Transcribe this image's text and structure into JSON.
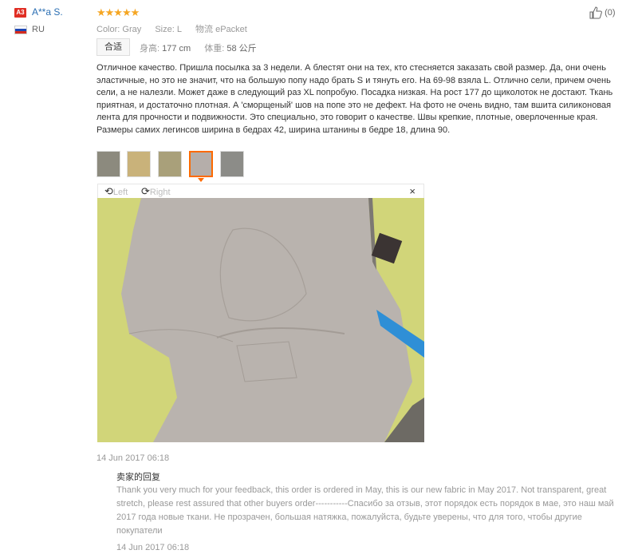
{
  "reviewer": {
    "badge": "A3",
    "name": "A**a S.",
    "country": "RU"
  },
  "rating": {
    "stars": 5,
    "max": 5,
    "glyphs": "★★★★★"
  },
  "attributes": [
    {
      "label": "Color:",
      "value": "Gray"
    },
    {
      "label": "Size:",
      "value": "L"
    },
    {
      "label": "物流",
      "value": "ePacket"
    }
  ],
  "likes": {
    "count": "(0)"
  },
  "fit": {
    "badge": "合适",
    "height_label": "身高:",
    "height_value": "177 cm",
    "weight_label": "体重:",
    "weight_value": "58 公斤"
  },
  "review_text": "Отличное качество. Пришла посылка за 3 недели. А блестят они на тех, кто стесняется заказать свой размер. Да, они очень эластичные, но это не значит, что на большую попу надо брать S и тянуть его. На 69-98 взяла L. Отлично сели, причем очень сели, а не налезли. Может даже в следующий раз XL попробую. Посадка низкая. На рост 177 до щиколоток не достают. Ткань приятная, и достаточно плотная. А 'сморщеный' шов на попе это не дефект. На фото не очень видно, там вшита силиконовая лента для прочности и подвижности. Это специально, это говорит о качестве. Швы крепкие, плотные, оверлоченные края. Размеры самих легинсов ширина в бедрах 42, ширина штанины в бедре 18, длина 90.",
  "thumbnails": [
    {
      "selected": false,
      "color": "#8c8a7e"
    },
    {
      "selected": false,
      "color": "#c9b27a"
    },
    {
      "selected": false,
      "color": "#a9a07a"
    },
    {
      "selected": true,
      "color": "#b5aeaa"
    },
    {
      "selected": false,
      "color": "#8c8c88"
    }
  ],
  "viewer": {
    "left_label": "Left",
    "right_label": "Right",
    "close": "×"
  },
  "review_date": "14 Jun 2017 06:18",
  "seller": {
    "title": "卖家的回复",
    "reply": "Thank you very much for your feedback, this order is ordered in May, this is our new fabric in May 2017. Not transparent, great stretch, please rest assured that other buyers order-----------Спасибо за отзыв, этот порядок есть порядок в мае, это наш май 2017 года новые ткани. Не прозрачен, большая натяжка, пожалуйста, будьте уверены, что для того, чтобы другие покупатели",
    "date": "14 Jun 2017 06:18"
  },
  "colors": {
    "accent": "#ff6a00",
    "star": "#f5a623",
    "link": "#2b6fb3"
  }
}
